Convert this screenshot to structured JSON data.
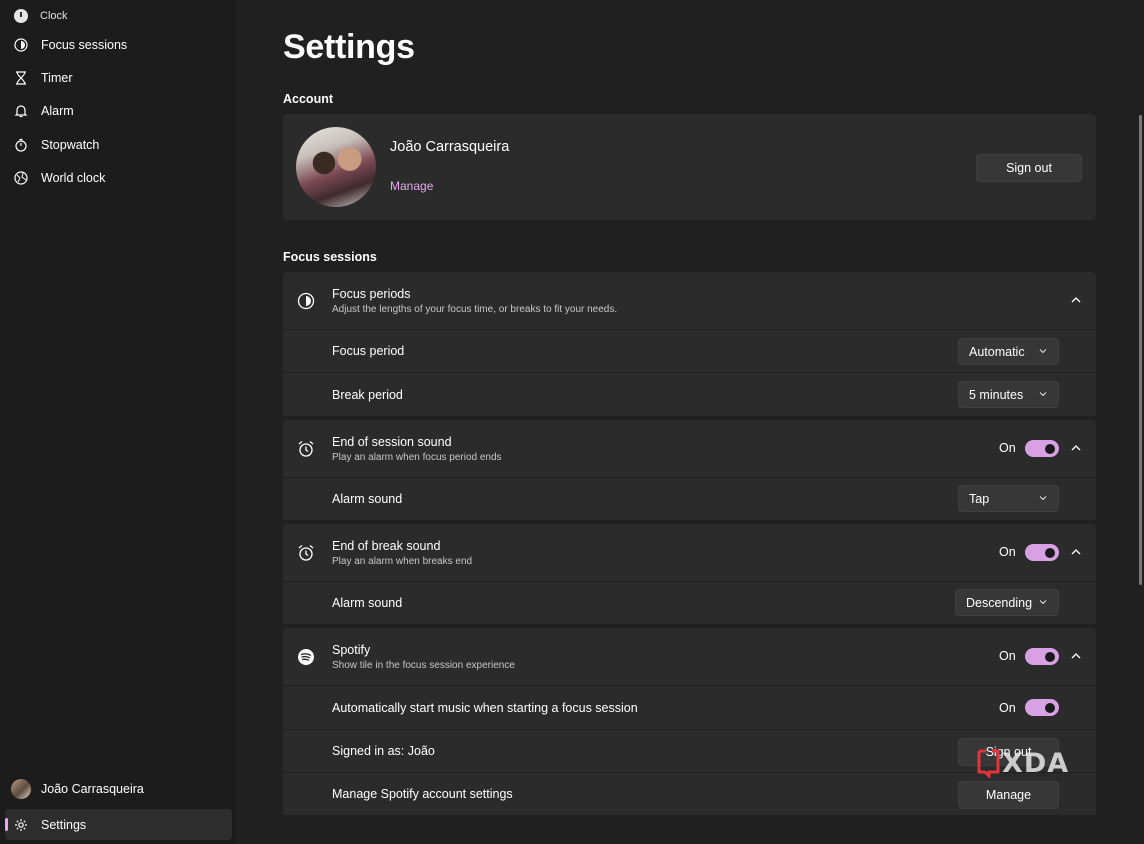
{
  "window": {
    "title": "Clock",
    "controls": [
      "minimize-icon",
      "maximize-icon",
      "close-icon"
    ]
  },
  "sidebar": {
    "items": [
      {
        "label": "Focus sessions",
        "icon": "focus-icon"
      },
      {
        "label": "Timer",
        "icon": "hourglass-icon"
      },
      {
        "label": "Alarm",
        "icon": "bell-icon"
      },
      {
        "label": "Stopwatch",
        "icon": "stopwatch-icon"
      },
      {
        "label": "World clock",
        "icon": "globe-icon"
      }
    ],
    "profile_name": "João Carrasqueira",
    "settings_label": "Settings"
  },
  "page": {
    "title": "Settings",
    "account_section": "Account",
    "account": {
      "name": "João Carrasqueira",
      "manage_label": "Manage",
      "sign_out_label": "Sign out"
    },
    "focus_section": "Focus sessions",
    "focus_periods": {
      "title": "Focus periods",
      "subtitle": "Adjust the lengths of your focus time, or breaks to fit your needs.",
      "focus_period_label": "Focus period",
      "focus_period_value": "Automatic",
      "break_period_label": "Break period",
      "break_period_value": "5 minutes"
    },
    "end_session_sound": {
      "title": "End of session sound",
      "subtitle": "Play an alarm when focus period ends",
      "toggle_label": "On",
      "alarm_sound_label": "Alarm sound",
      "alarm_sound_value": "Tap"
    },
    "end_break_sound": {
      "title": "End of break sound",
      "subtitle": "Play an alarm when breaks end",
      "toggle_label": "On",
      "alarm_sound_label": "Alarm sound",
      "alarm_sound_value": "Descending"
    },
    "spotify": {
      "title": "Spotify",
      "subtitle": "Show tile in the focus session experience",
      "toggle_label": "On",
      "auto_start_label": "Automatically start music when starting a focus session",
      "auto_start_toggle_label": "On",
      "signed_in_label": "Signed in as: João",
      "sign_out_label": "Sign out",
      "manage_settings_label": "Manage Spotify account settings",
      "manage_label": "Manage"
    }
  },
  "watermark": "XDA",
  "colors": {
    "accent": "#e6a7ec",
    "toggle_on": "#d8a1e3",
    "card": "#2b2b2b",
    "background": "#202020",
    "sidebar": "#1c1c1c"
  }
}
